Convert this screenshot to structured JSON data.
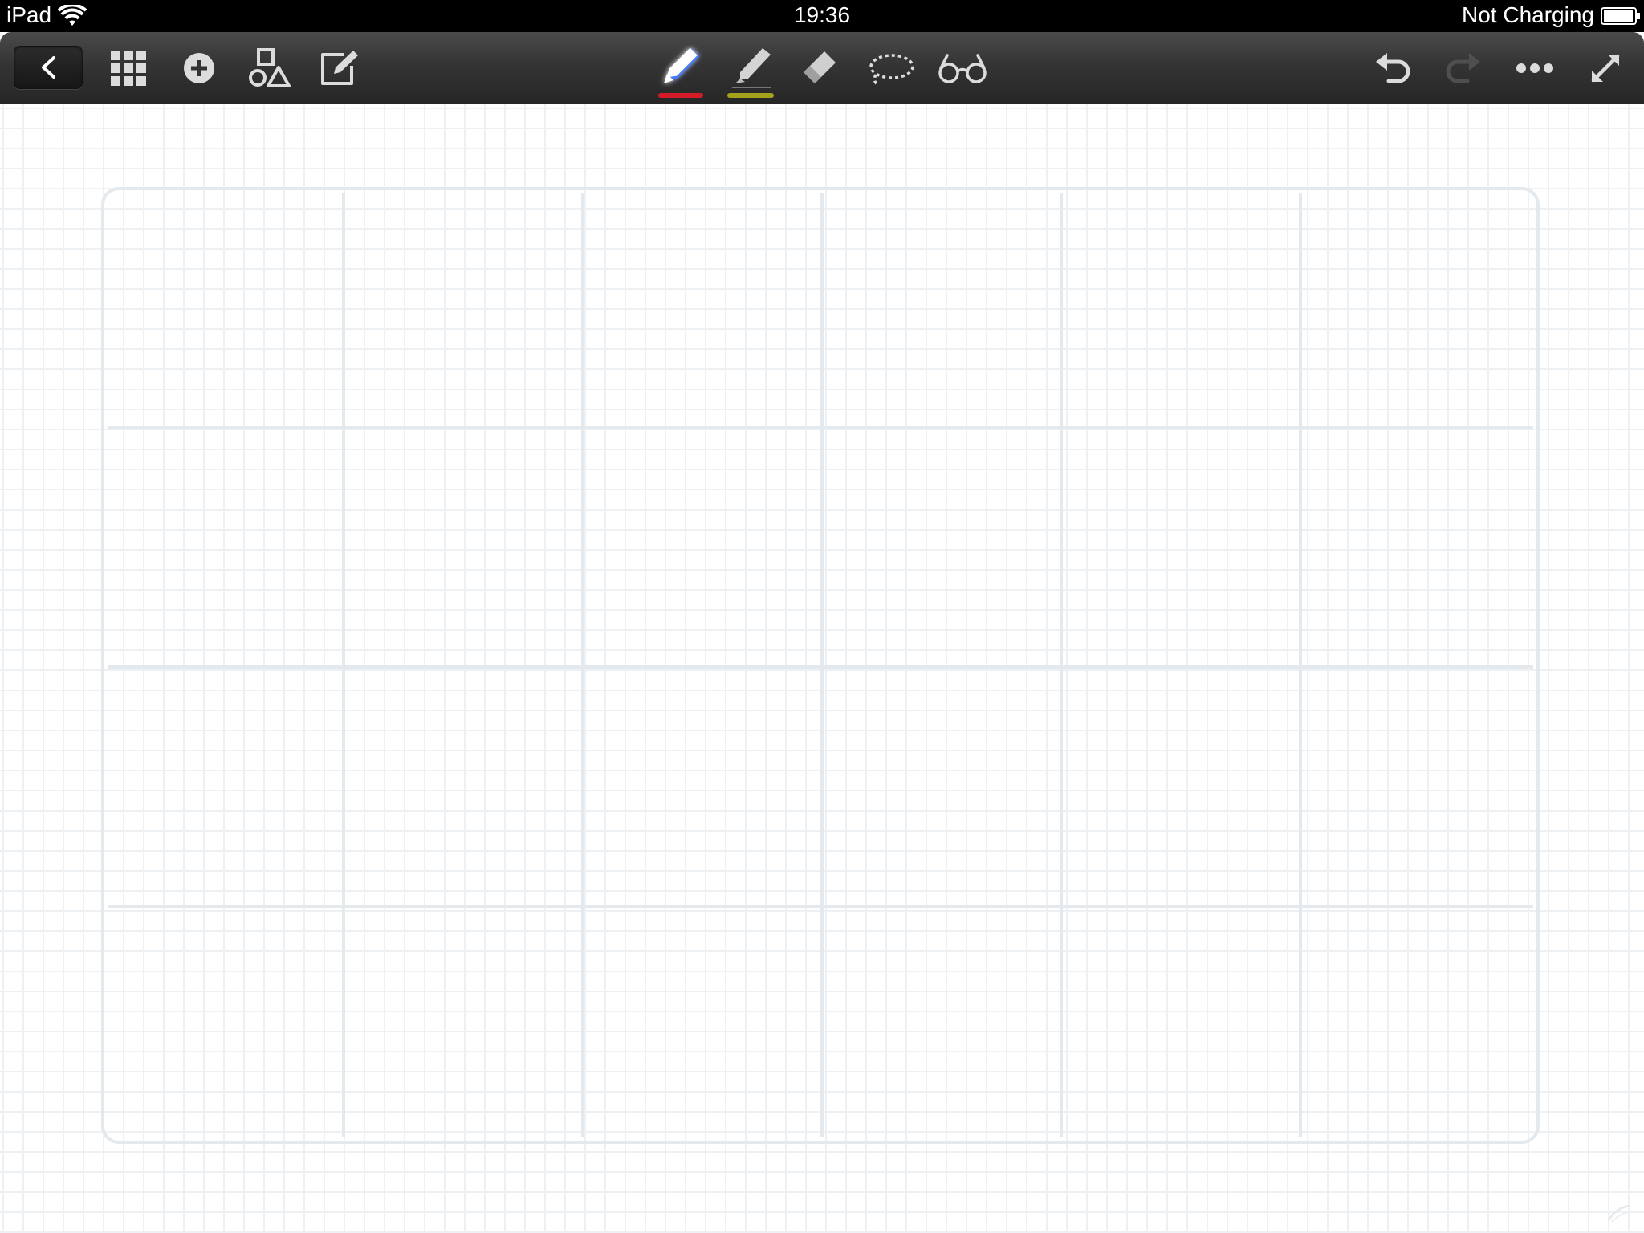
{
  "status_bar": {
    "device": "iPad",
    "time": "19:36",
    "battery_status": "Not Charging"
  },
  "toolbar": {
    "left_icons": [
      "back-arrow-icon",
      "grid-icon",
      "add-circle-icon",
      "shapes-icon",
      "edit-note-icon"
    ],
    "center_tools": [
      {
        "name": "pen",
        "icon": "pen-icon",
        "selected": true,
        "color": "#d41c28"
      },
      {
        "name": "highlighter",
        "icon": "highlighter-icon",
        "selected": false,
        "color": "#a4a11a"
      },
      {
        "name": "eraser",
        "icon": "eraser-icon",
        "selected": false
      },
      {
        "name": "lasso",
        "icon": "lasso-icon",
        "selected": false
      },
      {
        "name": "read-mode",
        "icon": "glasses-icon",
        "selected": false
      }
    ],
    "right_icons": [
      "undo-icon",
      "redo-icon",
      "more-icon",
      "fullscreen-icon"
    ]
  },
  "canvas": {
    "background": "grid-paper",
    "template_columns": 6,
    "template_rows": 4,
    "line_color": "#e4e9ed"
  },
  "colors": {
    "toolbar_bg": "#333333",
    "icon_color": "#dcdcdc",
    "selected_glow": "#3f7bff"
  }
}
